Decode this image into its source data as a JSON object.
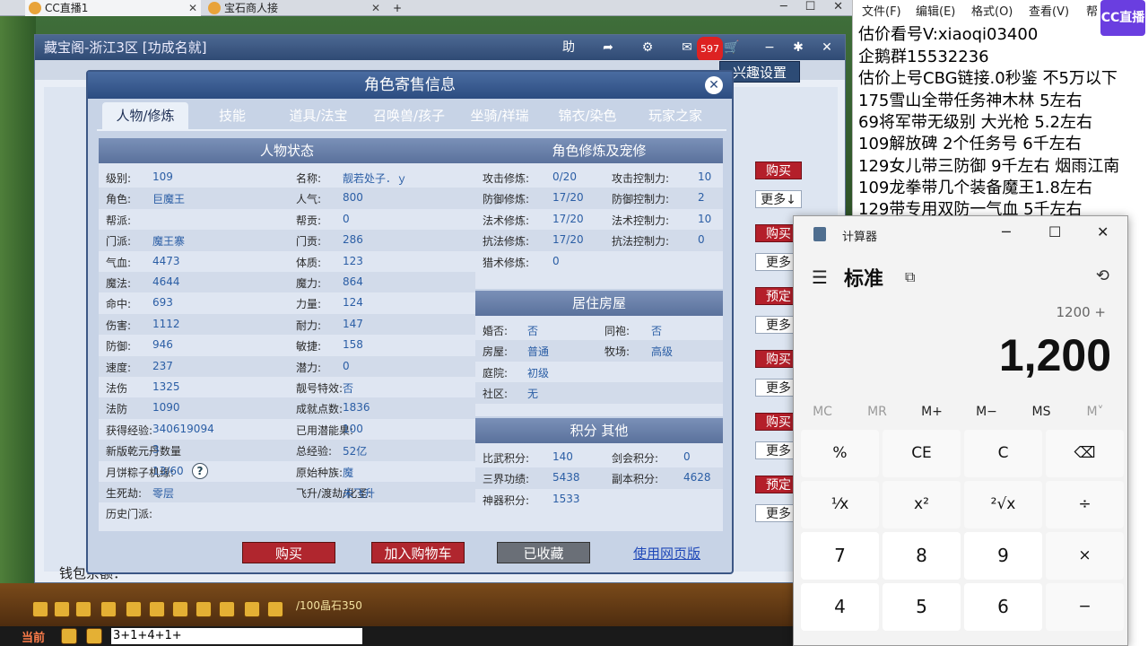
{
  "browser": {
    "tabs": [
      {
        "label": "CC直播1"
      },
      {
        "label": "宝石商人接"
      }
    ],
    "new_tab": "+"
  },
  "shop": {
    "title": "藏宝阁-浙江3区 [功成名就]",
    "help_label": "助",
    "cart_count": "597",
    "hobby_button": "兴趣设置",
    "wallet_label": "钱包余额：",
    "side_buttons": [
      {
        "label": "购买",
        "kind": "buy"
      },
      {
        "label": "更多↓",
        "kind": "more"
      },
      {
        "label": "购买",
        "kind": "buy"
      },
      {
        "label": "更多",
        "kind": "more"
      },
      {
        "label": "预定",
        "kind": "buy"
      },
      {
        "label": "更多",
        "kind": "more"
      },
      {
        "label": "购买",
        "kind": "buy"
      },
      {
        "label": "更多",
        "kind": "more"
      },
      {
        "label": "购买",
        "kind": "buy"
      },
      {
        "label": "更多",
        "kind": "more"
      },
      {
        "label": "预定",
        "kind": "buy"
      },
      {
        "label": "更多",
        "kind": "more"
      }
    ]
  },
  "dialog": {
    "title": "角色寄售信息",
    "tabs": [
      "人物/修炼",
      "技能",
      "道具/法宝",
      "召唤兽/孩子",
      "坐骑/祥瑞",
      "锦衣/染色",
      "玩家之家"
    ],
    "status_header": "人物状态",
    "left_rows": [
      {
        "l1": "级别:",
        "v1": "109",
        "l2": "名称:",
        "v2": "靓若处子．ｙ"
      },
      {
        "l1": "角色:",
        "v1": "巨魔王",
        "l2": "人气:",
        "v2": "800"
      },
      {
        "l1": "帮派:",
        "v1": "",
        "l2": "帮贡:",
        "v2": "0"
      },
      {
        "l1": "门派:",
        "v1": "魔王寨",
        "l2": "门贡:",
        "v2": "286"
      },
      {
        "l1": "气血:",
        "v1": "4473",
        "l2": "体质:",
        "v2": "123"
      },
      {
        "l1": "魔法:",
        "v1": "4644",
        "l2": "魔力:",
        "v2": "864"
      },
      {
        "l1": "命中:",
        "v1": "693",
        "l2": "力量:",
        "v2": "124"
      },
      {
        "l1": "伤害:",
        "v1": "1112",
        "l2": "耐力:",
        "v2": "147"
      },
      {
        "l1": "防御:",
        "v1": "946",
        "l2": "敏捷:",
        "v2": "158"
      },
      {
        "l1": "速度:",
        "v1": "237",
        "l2": "潜力:",
        "v2": "0"
      },
      {
        "l1": "法伤",
        "v1": "1325",
        "l2": "靓号特效:",
        "v2": "否"
      },
      {
        "l1": "法防",
        "v1": "1090",
        "l2": "成就点数:",
        "v2": "1836"
      },
      {
        "l1": "获得经验:",
        "v1": "340619094",
        "l2": "已用潜能果:",
        "v2": "100"
      },
      {
        "l1": "新版乾元丹数量",
        "v1": "3",
        "l2": "总经验:",
        "v2": "52亿"
      },
      {
        "l1": "月饼粽子机缘:",
        "v1": "13/60",
        "l2": "原始种族:",
        "v2": "魔"
      },
      {
        "l1": "生死劫:",
        "v1": "零层",
        "l2": "飞升/渡劫/化圣:",
        "v2": "未飞升"
      },
      {
        "l1": "历史门派:",
        "v1": "",
        "l2": "",
        "v2": ""
      }
    ],
    "cultivation_header": "角色修炼及宠修",
    "cultivation_rows": [
      {
        "l1": "攻击修炼:",
        "v1": "0/20",
        "l2": "攻击控制力:",
        "v2": "10"
      },
      {
        "l1": "防御修炼:",
        "v1": "17/20",
        "l2": "防御控制力:",
        "v2": "2"
      },
      {
        "l1": "法术修炼:",
        "v1": "17/20",
        "l2": "法术控制力:",
        "v2": "10"
      },
      {
        "l1": "抗法修炼:",
        "v1": "17/20",
        "l2": "抗法控制力:",
        "v2": "0"
      },
      {
        "l1": "猎术修炼:",
        "v1": "0",
        "l2": "",
        "v2": ""
      }
    ],
    "house_header": "居住房屋",
    "house_rows": [
      {
        "l1": "婚否:",
        "v1": "否",
        "l2": "同袍:",
        "v2": "否"
      },
      {
        "l1": "房屋:",
        "v1": "普通",
        "l2": "牧场:",
        "v2": "高级"
      },
      {
        "l1": "庭院:",
        "v1": "初级",
        "l2": "",
        "v2": ""
      },
      {
        "l1": "社区:",
        "v1": "无",
        "l2": "",
        "v2": ""
      }
    ],
    "points_header": "积分 其他",
    "points_rows": [
      {
        "l1": "比武积分:",
        "v1": "140",
        "l2": "剑会积分:",
        "v2": "0"
      },
      {
        "l1": "三界功绩:",
        "v1": "5438",
        "l2": "副本积分:",
        "v2": "4628"
      },
      {
        "l1": "神器积分:",
        "v1": "1533",
        "l2": "",
        "v2": ""
      }
    ],
    "buttons": {
      "buy": "购买",
      "cart": "加入购物车",
      "favorited": "已收藏",
      "web": "使用网页版"
    }
  },
  "game_bar": {
    "crystal_text": "/100晶石350",
    "channel": "当前",
    "chat_input": "3+1+4+1+"
  },
  "notepad": {
    "menu": [
      "文件(F)",
      "编辑(E)",
      "格式(O)",
      "查看(V)",
      "帮"
    ],
    "logo": "CC直播",
    "lines": [
      "估价看号V:xiaoqi03400",
      "企鹅群15532236",
      "估价上号CBG链接.0秒鉴 不5万以下",
      "175雪山全带任务神木林 5左右",
      "69将军带无级别 大光枪 5.2左右",
      "109解放碑 2个任务号 6千左右",
      "129女儿带三防御 9千左右 烟雨江南",
      "109龙拳带几个装备魔王1.8左右",
      "129带专用双防一气血 5千左右"
    ]
  },
  "calculator": {
    "title": "计算器",
    "mode": "标准",
    "expression": "1200 +",
    "display": "1,200",
    "memory": [
      {
        "label": "MC",
        "enabled": false
      },
      {
        "label": "MR",
        "enabled": false
      },
      {
        "label": "M+",
        "enabled": true
      },
      {
        "label": "M−",
        "enabled": true
      },
      {
        "label": "MS",
        "enabled": true
      },
      {
        "label": "M˅",
        "enabled": false
      }
    ],
    "keys": [
      {
        "label": "%",
        "name": "percent-key"
      },
      {
        "label": "CE",
        "name": "clear-entry-key"
      },
      {
        "label": "C",
        "name": "clear-key"
      },
      {
        "label": "⌫",
        "name": "backspace-key"
      },
      {
        "label": "¹⁄x",
        "name": "reciprocal-key"
      },
      {
        "label": "x²",
        "name": "square-key"
      },
      {
        "label": "²√x",
        "name": "sqrt-key"
      },
      {
        "label": "÷",
        "name": "divide-key"
      },
      {
        "label": "7",
        "name": "digit-7-key"
      },
      {
        "label": "8",
        "name": "digit-8-key"
      },
      {
        "label": "9",
        "name": "digit-9-key"
      },
      {
        "label": "×",
        "name": "multiply-key"
      },
      {
        "label": "4",
        "name": "digit-4-key"
      },
      {
        "label": "5",
        "name": "digit-5-key"
      },
      {
        "label": "6",
        "name": "digit-6-key"
      },
      {
        "label": "−",
        "name": "minus-key"
      }
    ]
  }
}
